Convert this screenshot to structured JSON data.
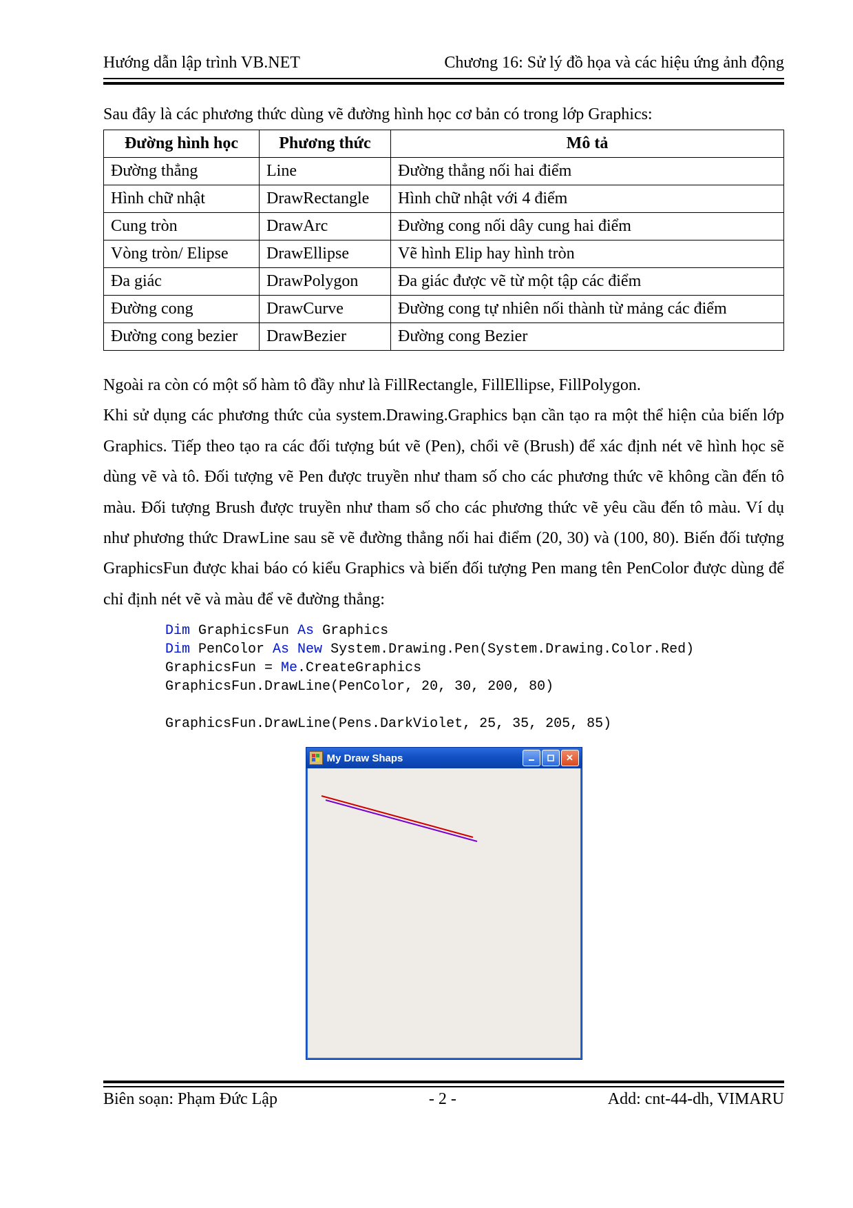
{
  "header": {
    "left": "Hướng dẫn lập trình VB.NET",
    "right": "Chương 16: Sử lý đồ họa và các hiệu ứng ảnh động"
  },
  "intro": "Sau đây là các phương thức dùng vẽ đường hình học cơ bản có trong lớp Graphics:",
  "table": {
    "headers": [
      "Đường hình học",
      "Phương thức",
      "Mô tả"
    ],
    "rows": [
      [
        "Đường thẳng",
        "Line",
        "Đường thẳng nối hai điểm"
      ],
      [
        "Hình chữ nhật",
        "DrawRectangle",
        "Hình chữ nhật với 4 điểm"
      ],
      [
        "Cung tròn",
        "DrawArc",
        "Đường cong nối dây cung hai điểm"
      ],
      [
        "Vòng tròn/ Elipse",
        "DrawEllipse",
        "Vẽ hình Elip hay hình tròn"
      ],
      [
        "Đa giác",
        "DrawPolygon",
        "Đa giác được vẽ từ một tập các điểm"
      ],
      [
        "Đường cong",
        "DrawCurve",
        "Đường cong tự nhiên nối thành từ mảng các điểm"
      ],
      [
        "Đường cong bezier",
        "DrawBezier",
        "Đường cong Bezier"
      ]
    ]
  },
  "body": {
    "p1": "Ngoài ra còn có một số hàm tô đầy như là FillRectangle, FillEllipse, FillPolygon.",
    "p2": "Khi sử dụng các phương thức của system.Drawing.Graphics bạn cần tạo ra một thể hiện của biến lớp Graphics. Tiếp theo tạo ra các đối tượng bút vẽ (Pen), chổi vẽ (Brush) để xác định nét vẽ hình học sẽ dùng vẽ và tô. Đối tượng vẽ Pen được truyền như tham số cho các phương thức vẽ không cần đến tô màu. Đối tượng Brush được truyền như tham số cho các phương thức vẽ yêu cầu đến tô màu. Ví dụ như phương thức DrawLine sau sẽ vẽ đường thẳng nối hai điểm (20, 30) và (100, 80). Biến đối tượng GraphicsFun được khai báo có kiểu Graphics và biến đối tượng Pen mang tên PenColor được dùng để chỉ định nét vẽ và màu để vẽ đường thẳng:"
  },
  "code": {
    "tokens": [
      {
        "t": "Dim",
        "k": true
      },
      {
        "t": " GraphicsFun "
      },
      {
        "t": "As",
        "k": true
      },
      {
        "t": " Graphics\n"
      },
      {
        "t": "Dim",
        "k": true
      },
      {
        "t": " PenColor "
      },
      {
        "t": "As New",
        "k": true
      },
      {
        "t": " System.Drawing.Pen(System.Drawing.Color.Red)\n"
      },
      {
        "t": "GraphicsFun = "
      },
      {
        "t": "Me",
        "k": true
      },
      {
        "t": ".CreateGraphics\n"
      },
      {
        "t": "GraphicsFun.DrawLine(PenColor, 20, 30, 200, 80)\n\n"
      },
      {
        "t": "GraphicsFun.DrawLine(Pens.DarkViolet, 25, 35, 205, 85)"
      }
    ]
  },
  "window": {
    "title": "My Draw Shaps"
  },
  "footer": {
    "left": "Biên soạn: Phạm Đức Lập",
    "center": "- 2 -",
    "right": "Add: cnt-44-dh, VIMARU"
  }
}
